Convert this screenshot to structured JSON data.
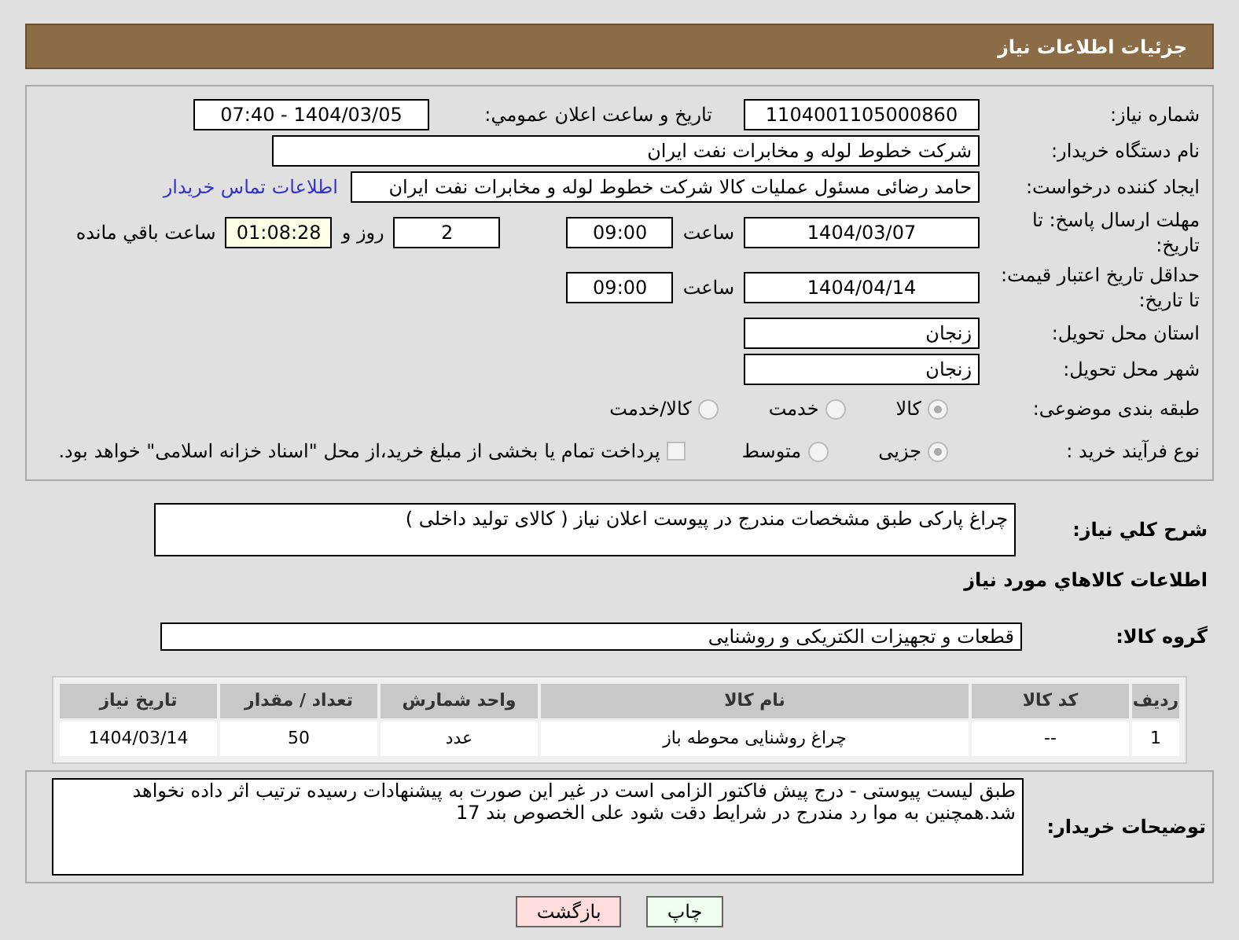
{
  "header": {
    "title": "جزئیات اطلاعات نیاز"
  },
  "form": {
    "need_number": {
      "label": "شماره نیاز:",
      "value": "1104001105000860"
    },
    "announcement": {
      "label": "تاریخ و ساعت اعلان عمومي:",
      "value": "1404/03/05 - 07:40"
    },
    "buyer_org": {
      "label": "نام دستگاه خريدار:",
      "value": "شرکت خطوط لوله و مخابرات نفت ایران"
    },
    "requester": {
      "label": "ایجاد کننده درخواست:",
      "value": "حامد  رضائی  مسئول عملیات کالا  شرکت خطوط لوله و مخابرات نفت ایران",
      "link": "اطلاعات تماس خریدار"
    },
    "reply_deadline": {
      "label": "مهلت ارسال پاسخ: تا تاریخ:",
      "date": "1404/03/07",
      "time_label": "ساعت",
      "time": "09:00",
      "days": "2",
      "days_label": "روز و",
      "remaining": "01:08:28",
      "remaining_label": "ساعت باقي مانده"
    },
    "price_validity": {
      "label": "حداقل تاریخ اعتبار قیمت: تا تاریخ:",
      "date": "1404/04/14",
      "time_label": "ساعت",
      "time": "09:00"
    },
    "province": {
      "label": "استان محل تحویل:",
      "value": "زنجان"
    },
    "city": {
      "label": "شهر محل تحویل:",
      "value": "زنجان"
    },
    "category": {
      "label": "طبقه بندی موضوعی:",
      "options": [
        {
          "label": "کالا",
          "selected": true
        },
        {
          "label": "خدمت",
          "selected": false
        },
        {
          "label": "کالا/خدمت",
          "selected": false
        }
      ]
    },
    "process": {
      "label": "نوع فرآیند خرید :",
      "options": [
        {
          "label": "جزیی",
          "selected": true
        },
        {
          "label": "متوسط",
          "selected": false
        }
      ],
      "payment": {
        "checked": false,
        "text": "پرداخت تمام یا بخشی از مبلغ خرید،از محل \"اسناد خزانه اسلامی\" خواهد بود."
      }
    }
  },
  "description": {
    "label": "شرح کلي نياز:",
    "value": "چراغ پارکی طبق مشخصات مندرج در پیوست اعلان نیاز ( کالای تولید داخلی )"
  },
  "goods": {
    "title": "اطلاعات کالاهاي مورد نياز",
    "group_label": "گروه کالا:",
    "group_value": "قطعات و تجهیزات الکتریکی و روشنایی"
  },
  "table": {
    "columns": [
      "ردیف",
      "کد کالا",
      "نام کالا",
      "واحد شمارش",
      "تعداد / مقدار",
      "تاریخ نیاز"
    ],
    "rows": [
      [
        "1",
        "--",
        "چراغ روشنایی محوطه باز",
        "عدد",
        "50",
        "1404/03/14"
      ]
    ]
  },
  "buyer_notes": {
    "label": "توضیحات خریدار:",
    "value": "طبق لیست پیوستی - درج پیش فاکتور الزامی است در غیر این صورت به پیشنهادات رسیده ترتیب اثر داده نخواهد شد.همچنین به موا رد مندرج در شرایط دقت شود علی الخصوص بند 17"
  },
  "buttons": [
    {
      "label": "چاپ",
      "kind": "print"
    },
    {
      "label": "بازگشت",
      "kind": "back"
    }
  ]
}
